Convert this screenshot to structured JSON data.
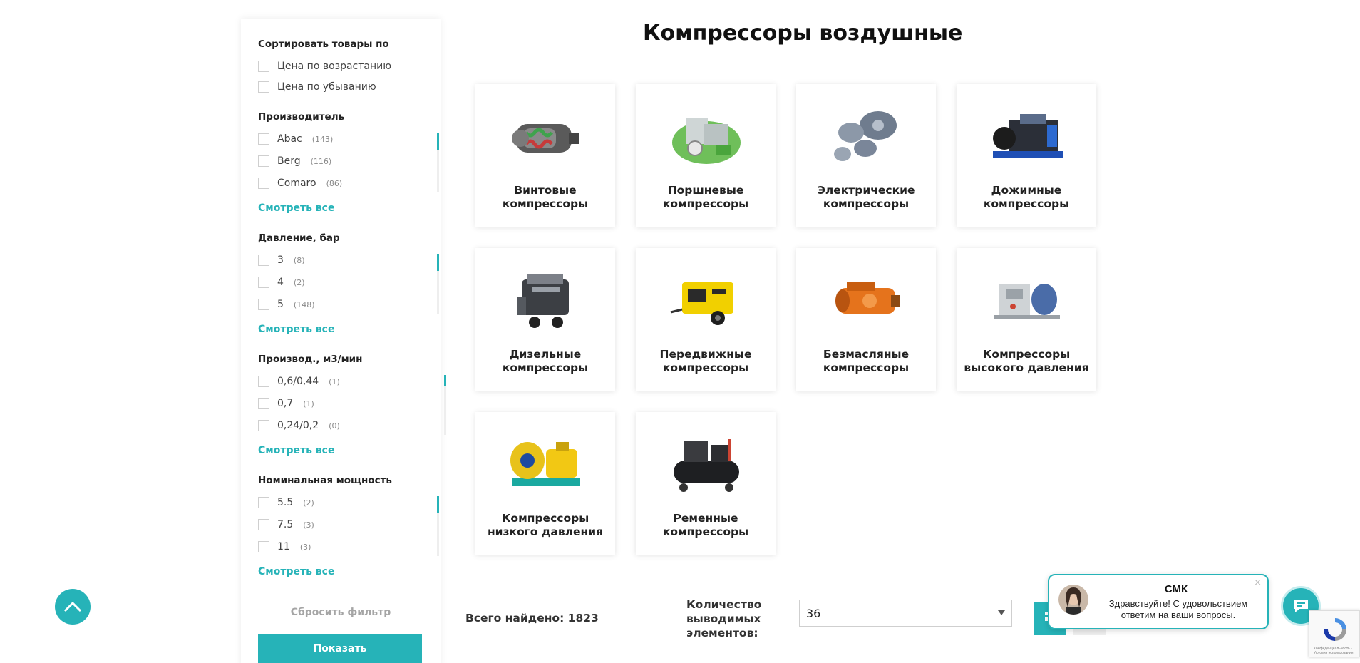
{
  "page": {
    "title": "Компрессоры воздушные"
  },
  "sidebar": {
    "sort": {
      "heading": "Сортировать товары по",
      "options": [
        "Цена по возрастанию",
        "Цена по убыванию"
      ]
    },
    "filters": [
      {
        "heading": "Производитель",
        "items": [
          {
            "label": "Abac",
            "count": "(143)"
          },
          {
            "label": "Berg",
            "count": "(116)"
          },
          {
            "label": "Comaro",
            "count": "(86)"
          }
        ],
        "see_all": "Смотреть все"
      },
      {
        "heading": "Давление, бар",
        "items": [
          {
            "label": "3",
            "count": "(8)"
          },
          {
            "label": "4",
            "count": "(2)"
          },
          {
            "label": "5",
            "count": "(148)"
          }
        ],
        "see_all": "Смотреть все"
      },
      {
        "heading": "Производ., м3/мин",
        "items": [
          {
            "label": "0,6/0,44",
            "count": "(1)"
          },
          {
            "label": "0,7",
            "count": "(1)"
          },
          {
            "label": "0,24/0,2",
            "count": "(0)"
          }
        ],
        "see_all": "Смотреть все"
      },
      {
        "heading": "Номинальная мощность",
        "items": [
          {
            "label": "5.5",
            "count": "(2)"
          },
          {
            "label": "7.5",
            "count": "(3)"
          },
          {
            "label": "11",
            "count": "(3)"
          }
        ],
        "see_all": "Смотреть все"
      }
    ],
    "reset_label": "Сбросить фильтр",
    "show_label": "Показать"
  },
  "categories": [
    {
      "line1": "Винтовые",
      "line2": "компрессоры",
      "icon": "screw-compressor-image"
    },
    {
      "line1": "Поршневые",
      "line2": "компрессоры",
      "icon": "piston-compressor-image"
    },
    {
      "line1": "Электрические",
      "line2": "компрессоры",
      "icon": "electric-compressor-image"
    },
    {
      "line1": "Дожимные",
      "line2": "компрессоры",
      "icon": "booster-compressor-image"
    },
    {
      "line1": "Дизельные",
      "line2": "компрессоры",
      "icon": "diesel-compressor-image"
    },
    {
      "line1": "Передвижные",
      "line2": "компрессоры",
      "icon": "mobile-compressor-image"
    },
    {
      "line1": "Безмасляные",
      "line2": "компрессоры",
      "icon": "oil-free-compressor-image"
    },
    {
      "line1": "Компрессоры",
      "line2": "высокого давления",
      "icon": "high-pressure-compressor-image"
    },
    {
      "line1": "Компрессоры",
      "line2": "низкого давления",
      "icon": "low-pressure-compressor-image"
    },
    {
      "line1": "Ременные",
      "line2": "компрессоры",
      "icon": "belt-compressor-image"
    }
  ],
  "results": {
    "total_label": "Всего найдено: 1823",
    "qty_label": "Количество выводимых элементов:",
    "qty_value": "36"
  },
  "chat": {
    "name": "СМК",
    "message": "Здравствуйте! С удовольствием ответим на ваши вопросы.",
    "close": "×"
  },
  "recaptcha": {
    "text": "Конфиденциальность - Условия использования"
  },
  "colors": {
    "accent": "#26b3b8",
    "text": "#222222"
  }
}
